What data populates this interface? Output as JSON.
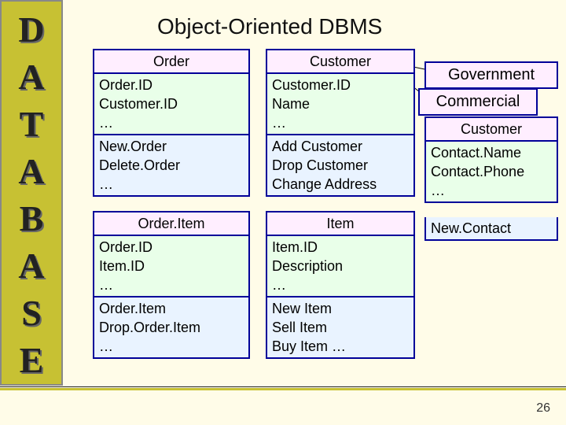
{
  "title": "Object-Oriented DBMS",
  "slide_number": "26",
  "sidebar_letters": [
    "D",
    "A",
    "T",
    "A",
    "B",
    "A",
    "S",
    "E"
  ],
  "classes": {
    "order": {
      "name": "Order",
      "attrs": "Order.ID\nCustomer.ID\n…",
      "ops": "New.Order\nDelete.Order\n…"
    },
    "customer": {
      "name": "Customer",
      "attrs": "Customer.ID\nName\n…",
      "ops": "Add Customer\nDrop Customer\nChange Address"
    },
    "orderitem": {
      "name": "Order.Item",
      "attrs": "Order.ID\nItem.ID\n…",
      "ops": "Order.Item\nDrop.Order.Item\n…"
    },
    "item": {
      "name": "Item",
      "attrs": "Item.ID\nDescription\n…",
      "ops": "New Item\nSell Item\nBuy Item …"
    },
    "contact": {
      "name": "Customer",
      "attrs": "Contact.Name\nContact.Phone\n…",
      "ops": "New.Contact"
    }
  },
  "subclasses": {
    "government": "Government",
    "commercial": "Commercial"
  }
}
